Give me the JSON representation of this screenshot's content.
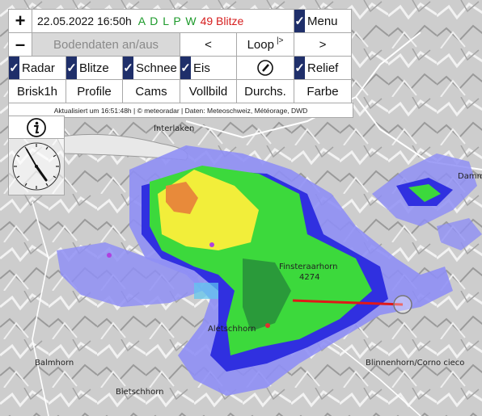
{
  "toolbar": {
    "zoom_in": "+",
    "zoom_out": "–",
    "datetime": "22.05.2022 16:50h",
    "sources": "A D L P W",
    "lightning_count": "49 Blitze",
    "menu": "Menu",
    "ground_data": "Bodendaten an/aus",
    "prev": "<",
    "loop": "Loop",
    "loop_symbol": "|>",
    "next": ">"
  },
  "layers": {
    "radar": "Radar",
    "blitze": "Blitze",
    "schnee": "Schnee",
    "eis": "Eis",
    "relief": "Relief"
  },
  "actions": {
    "brisk": "Brisk1h",
    "profile": "Profile",
    "cams": "Cams",
    "vollbild": "Vollbild",
    "durchs": "Durchs.",
    "farbe": "Farbe"
  },
  "credit": "Aktualisiert um 16:51:48h | © meteoradar | Daten: Meteoschweiz, Météorage, DWD",
  "map": {
    "places": [
      {
        "name": "Interlaken"
      },
      {
        "name": "Finsteraarhorn"
      },
      {
        "name": "4274"
      },
      {
        "name": "Aletschhorn"
      },
      {
        "name": "Balmhorn"
      },
      {
        "name": "Bietschhorn"
      },
      {
        "name": "Blinnenhorn/Corno cieco"
      },
      {
        "name": "Damm"
      }
    ]
  },
  "colors": {
    "radar_light": "#8f8ff5",
    "radar_blue": "#3030e0",
    "radar_green": "#3cd93c",
    "radar_dkgreen": "#2a9a3a",
    "radar_yellow": "#f2ee3a",
    "radar_orange": "#e88a3a",
    "lightning_line": "#e01818"
  }
}
